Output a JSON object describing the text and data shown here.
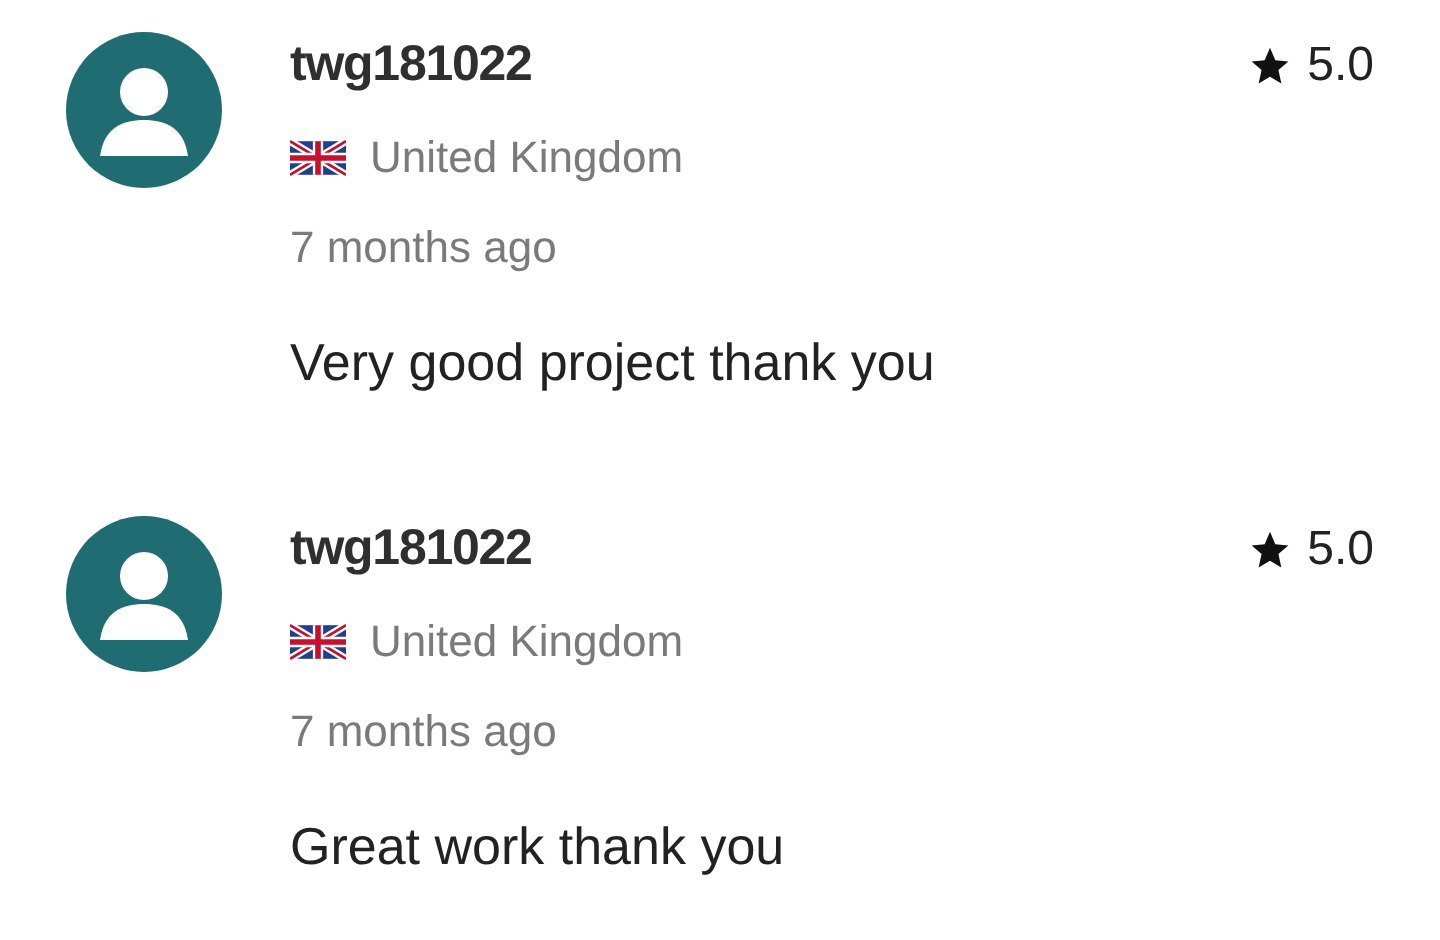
{
  "reviews": [
    {
      "username": "twg181022",
      "rating": "5.0",
      "country": "United Kingdom",
      "time": "7 months ago",
      "text": "Very good project thank you"
    },
    {
      "username": "twg181022",
      "rating": "5.0",
      "country": "United Kingdom",
      "time": "7 months ago",
      "text": "Great work thank you"
    }
  ]
}
